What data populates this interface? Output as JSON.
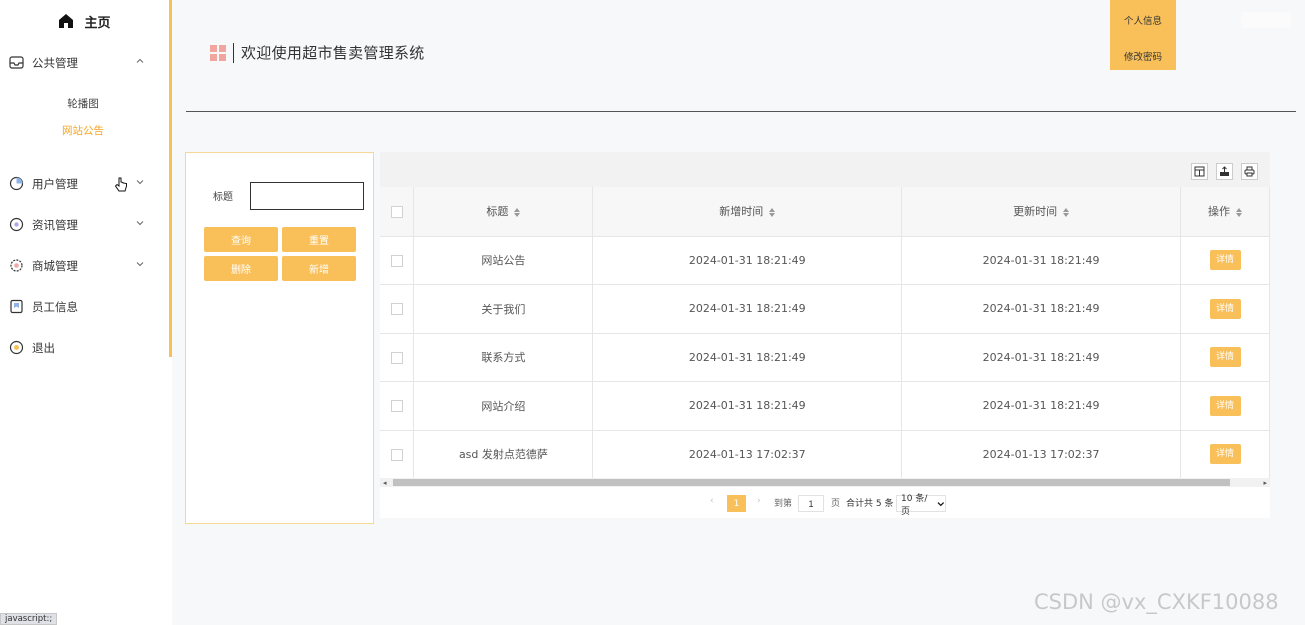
{
  "sidebar": {
    "brand": "主页",
    "items": [
      {
        "label": "公共管理",
        "icon": "mailbox-icon",
        "expanded": true
      },
      {
        "label": "用户管理",
        "icon": "user-circle-icon",
        "expanded": false
      },
      {
        "label": "资讯管理",
        "icon": "news-icon",
        "expanded": false
      },
      {
        "label": "商城管理",
        "icon": "gear-icon",
        "expanded": false
      },
      {
        "label": "员工信息",
        "icon": "bookmark-icon"
      },
      {
        "label": "退出",
        "icon": "exit-icon"
      }
    ],
    "subitems": [
      {
        "label": "轮播图",
        "active": false
      },
      {
        "label": "网站公告",
        "active": true
      }
    ]
  },
  "header": {
    "title": "欢迎使用超市售卖管理系统",
    "user_info": "个人信息",
    "change_password": "修改密码"
  },
  "search": {
    "label": "标题",
    "value": "",
    "buttons": {
      "query": "查询",
      "reset": "重置",
      "delete": "删除",
      "add": "新增"
    }
  },
  "table": {
    "columns": [
      "标题",
      "新增时间",
      "更新时间",
      "操作"
    ],
    "rows": [
      {
        "title": "网站公告",
        "created": "2024-01-31 18:21:49",
        "updated": "2024-01-31 18:21:49",
        "action": "详情"
      },
      {
        "title": "关于我们",
        "created": "2024-01-31 18:21:49",
        "updated": "2024-01-31 18:21:49",
        "action": "详情"
      },
      {
        "title": "联系方式",
        "created": "2024-01-31 18:21:49",
        "updated": "2024-01-31 18:21:49",
        "action": "详情"
      },
      {
        "title": "网站介绍",
        "created": "2024-01-31 18:21:49",
        "updated": "2024-01-31 18:21:49",
        "action": "详情"
      },
      {
        "title": "asd 发射点范德萨",
        "created": "2024-01-13 17:02:37",
        "updated": "2024-01-13 17:02:37",
        "action": "详情"
      }
    ]
  },
  "pagination": {
    "current_page": "1",
    "goto_label": "到第",
    "page_input": "1",
    "page_unit": "页",
    "total": "合计共 5 条",
    "page_size": "10 条/页"
  },
  "colors": {
    "accent": "#f9c05a",
    "active_text": "#f5a623"
  },
  "watermark": "CSDN @vx_CXKF10088",
  "status_bar": "javascript:;"
}
